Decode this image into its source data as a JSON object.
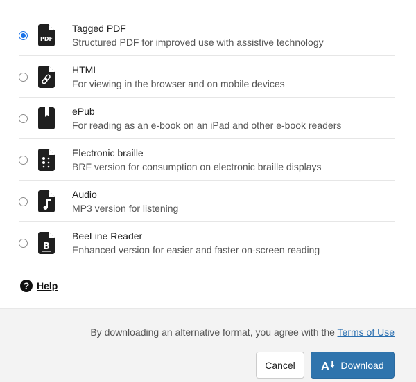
{
  "formats": [
    {
      "id": "tagged-pdf",
      "title": "Tagged PDF",
      "description": "Structured PDF for improved use with assistive technology",
      "icon": "pdf-file-icon",
      "selected": true
    },
    {
      "id": "html",
      "title": "HTML",
      "description": "For viewing in the browser and on mobile devices",
      "icon": "link-file-icon",
      "selected": false
    },
    {
      "id": "epub",
      "title": "ePub",
      "description": "For reading as an e-book on an iPad and other e-book readers",
      "icon": "book-bookmark-icon",
      "selected": false
    },
    {
      "id": "braille",
      "title": "Electronic braille",
      "description": "BRF version for consumption on electronic braille displays",
      "icon": "braille-file-icon",
      "selected": false
    },
    {
      "id": "audio",
      "title": "Audio",
      "description": "MP3 version for listening",
      "icon": "audio-file-icon",
      "selected": false
    },
    {
      "id": "beeline",
      "title": "BeeLine Reader",
      "description": "Enhanced version for easier and faster on-screen reading",
      "icon": "beeline-file-icon",
      "selected": false
    }
  ],
  "help": {
    "icon_glyph": "?",
    "label": "Help"
  },
  "footer": {
    "agreement_text": "By downloading an alternative format, you agree with the ",
    "terms_link": "Terms of Use",
    "cancel_label": "Cancel",
    "download_label": "Download"
  },
  "colors": {
    "accent": "#2f74ad",
    "radio_selected": "#1a73e8",
    "footer_bg": "#f3f3f3"
  }
}
